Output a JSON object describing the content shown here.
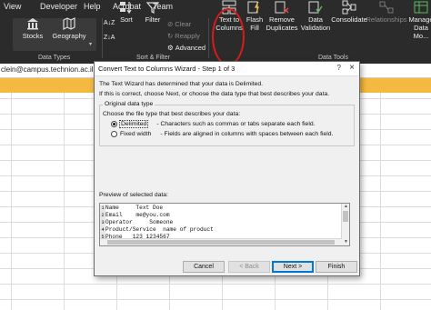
{
  "ribbon": {
    "tabs": [
      "View",
      "Developer",
      "Help",
      "Acrobat",
      "Team"
    ],
    "data_types": {
      "stocks": "Stocks",
      "geography": "Geography",
      "group": "Data Types"
    },
    "sort": "Sort",
    "filter": "Filter",
    "clear": "Clear",
    "reapply": "Reapply",
    "advanced": "Advanced",
    "sort_filter_group": "Sort & Filter",
    "text_to_columns": "Text to Columns",
    "flash_fill": "Flash Fill",
    "remove_duplicates": "Remove Duplicates",
    "data_validation": "Data Validation",
    "consolidate": "Consolidate",
    "relationships": "Relationships",
    "manage_data_model": "Manage Data Mo...",
    "data_tools_group": "Data Tools"
  },
  "namebar": {
    "email": "clein@campus.technion.ac.il so w"
  },
  "dialog": {
    "title": "Convert Text to Columns Wizard - Step 1 of 3",
    "help": "?",
    "close": "×",
    "intro1": "The Text Wizard has determined that your data is Delimited.",
    "intro2": "If this is correct, choose Next, or choose the data type that best describes your data.",
    "group_title": "Original data type",
    "choose_label": "Choose the file type that best describes your data:",
    "option_delimited": "Delimited",
    "option_delimited_desc": "- Characters such as commas or tabs separate each field.",
    "option_fixed": "Fixed width",
    "option_fixed_desc": "- Fields are aligned in columns with spaces between each field.",
    "preview_label": "Preview of selected data:",
    "preview_rows": [
      {
        "n": "1",
        "text": "Name     Text Doe"
      },
      {
        "n": "2",
        "text": "Email    me@you.com"
      },
      {
        "n": "3",
        "text": "Operator     Someone"
      },
      {
        "n": "4",
        "text": "Product/Service  name of product"
      },
      {
        "n": "5",
        "text": "Phone   123 1234567"
      }
    ],
    "buttons": {
      "cancel": "Cancel",
      "back": "< Back",
      "next": "Next >",
      "finish": "Finish"
    }
  },
  "colors": {
    "ribbon_bg": "#2b2b2b",
    "notification": "#f4b940",
    "annotation": "#d81b1b",
    "default_button": "#0078d7"
  }
}
